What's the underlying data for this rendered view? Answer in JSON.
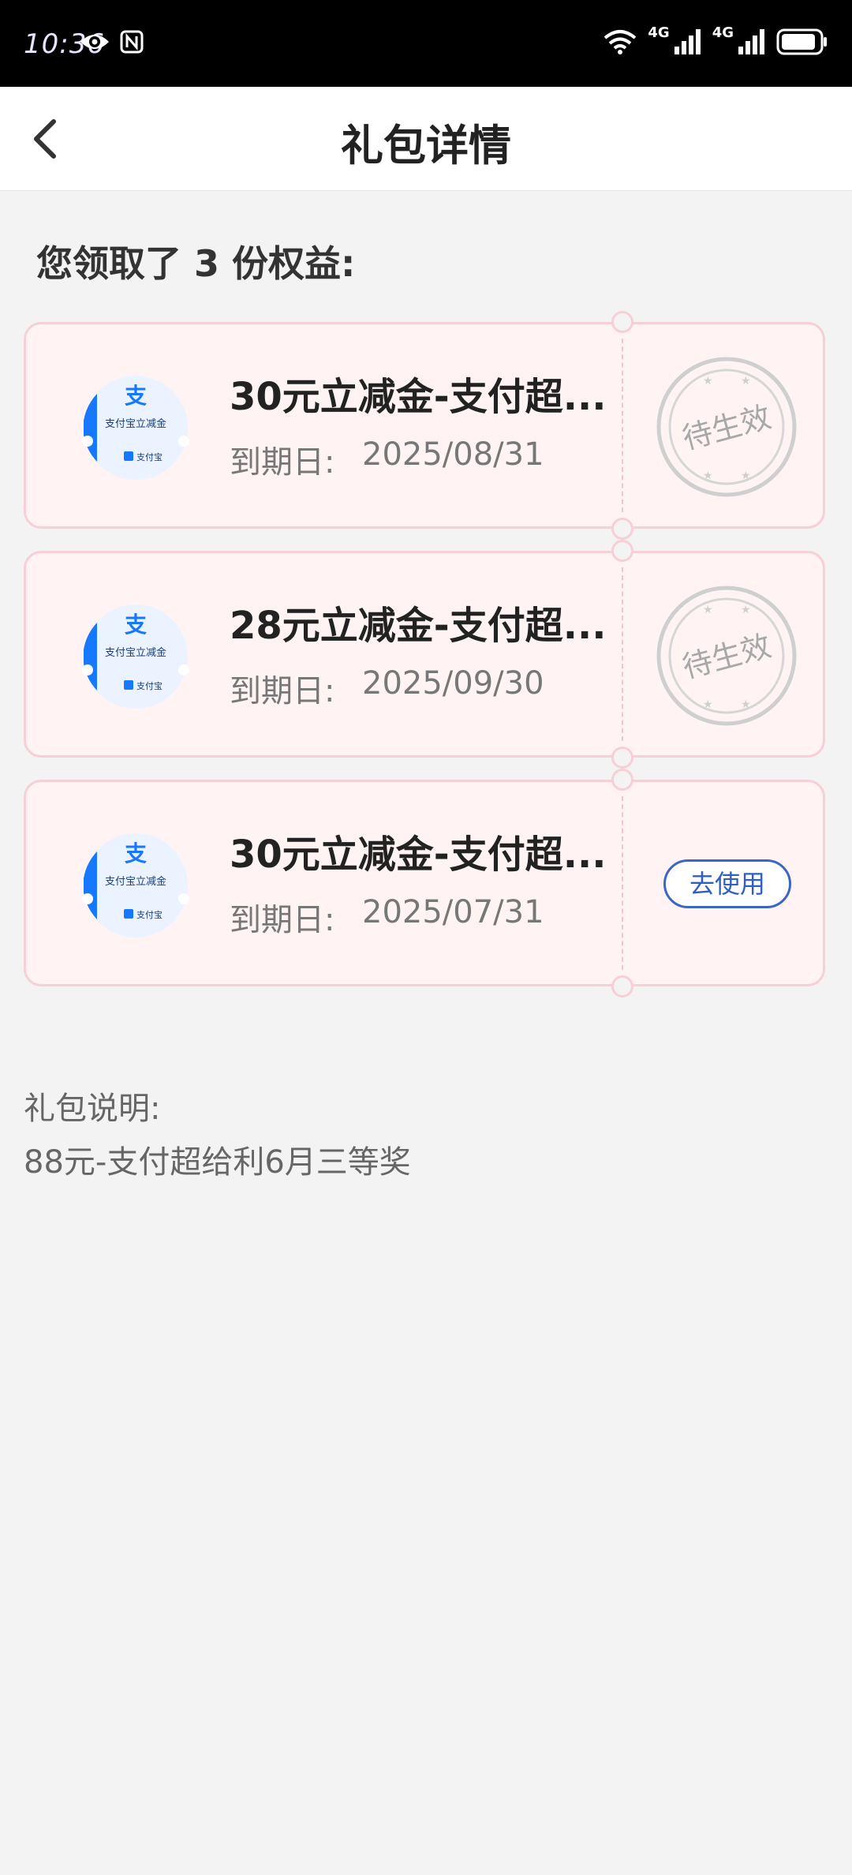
{
  "status_bar": {
    "time": "10:36",
    "net1": "4G",
    "net2": "4G"
  },
  "header": {
    "title": "礼包详情"
  },
  "summary": "您领取了 3 份权益:",
  "coupons": [
    {
      "thumb_title": "支付宝立减金",
      "thumb_brand": "支付宝",
      "title": "30元立减金-支付超...",
      "expire_label": "到期日:",
      "expire_date": "2025/08/31",
      "status": "待生效"
    },
    {
      "thumb_title": "支付宝立减金",
      "thumb_brand": "支付宝",
      "title": "28元立减金-支付超...",
      "expire_label": "到期日:",
      "expire_date": "2025/09/30",
      "status": "待生效"
    },
    {
      "thumb_title": "支付宝立减金",
      "thumb_brand": "支付宝",
      "title": "30元立减金-支付超...",
      "expire_label": "到期日:",
      "expire_date": "2025/07/31",
      "action_label": "去使用"
    }
  ],
  "description": {
    "label": "礼包说明:",
    "text": "88元-支付超给利6月三等奖"
  },
  "colors": {
    "accent": "#3a66c4",
    "card_bg": "#fff3f3",
    "card_border": "#f7cfd6"
  }
}
